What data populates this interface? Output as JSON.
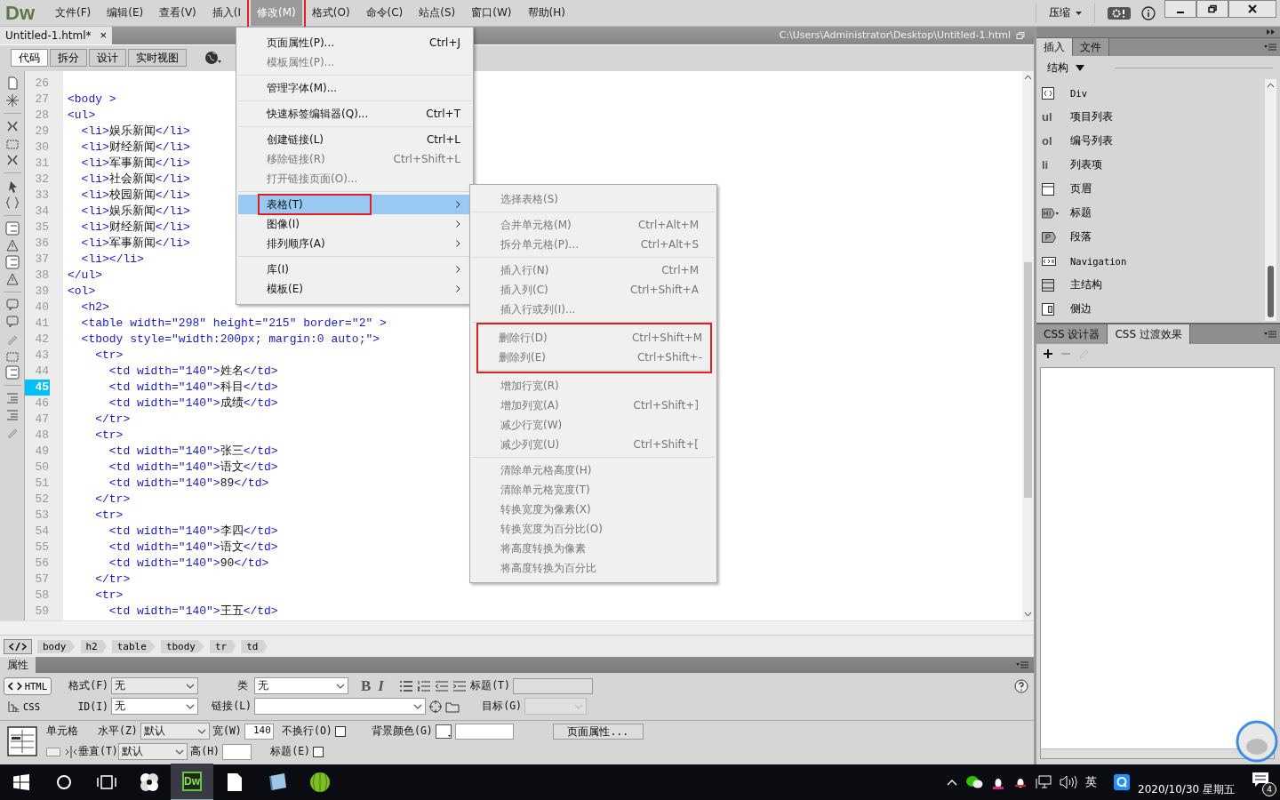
{
  "menubar": {
    "logo": "Dw",
    "items": [
      {
        "label": "文件(F)",
        "selected": false,
        "outlined": false
      },
      {
        "label": "编辑(E)",
        "selected": false,
        "outlined": false
      },
      {
        "label": "查看(V)",
        "selected": false,
        "outlined": false
      },
      {
        "label": "插入(I",
        "selected": false,
        "outlined": false
      },
      {
        "label": "修改(M)",
        "selected": true,
        "outlined": true
      },
      {
        "label": "格式(O)",
        "selected": false,
        "outlined": false
      },
      {
        "label": "命令(C)",
        "selected": false,
        "outlined": false
      },
      {
        "label": "站点(S)",
        "selected": false,
        "outlined": false
      },
      {
        "label": "窗口(W)",
        "selected": false,
        "outlined": false
      },
      {
        "label": "帮助(H)",
        "selected": false,
        "outlined": false
      }
    ],
    "workspace": "压缩"
  },
  "dropdown": {
    "sections": [
      {
        "items": [
          {
            "label": "页面属性(P)...",
            "shortcut": "Ctrl+J",
            "disabled": false,
            "selected": false,
            "submenu": false,
            "outlined": false
          },
          {
            "label": "模板属性(P)...",
            "disabled": true,
            "selected": false,
            "submenu": false,
            "outlined": false
          }
        ]
      },
      {
        "items": [
          {
            "label": "管理字体(M)...",
            "disabled": false,
            "selected": false,
            "submenu": false,
            "outlined": false
          }
        ]
      },
      {
        "items": [
          {
            "label": "快速标签编辑器(Q)...",
            "shortcut": "Ctrl+T",
            "disabled": false,
            "selected": false,
            "submenu": false,
            "outlined": false
          }
        ]
      },
      {
        "items": [
          {
            "label": "创建链接(L)",
            "shortcut": "Ctrl+L",
            "disabled": false,
            "selected": false,
            "submenu": false,
            "outlined": false
          },
          {
            "label": "移除链接(R)",
            "shortcut": "Ctrl+Shift+L",
            "disabled": true,
            "selected": false,
            "submenu": false,
            "outlined": false
          },
          {
            "label": "打开链接页面(O)...",
            "disabled": true,
            "selected": false,
            "submenu": false,
            "outlined": false
          }
        ]
      },
      {
        "items": [
          {
            "label": "表格(T)",
            "disabled": false,
            "selected": true,
            "submenu": true,
            "outlined": true
          },
          {
            "label": "图像(I)",
            "disabled": false,
            "selected": false,
            "submenu": true,
            "outlined": false
          },
          {
            "label": "排列顺序(A)",
            "disabled": false,
            "selected": false,
            "submenu": true,
            "outlined": false
          }
        ]
      },
      {
        "items": [
          {
            "label": "库(I)",
            "disabled": false,
            "selected": false,
            "submenu": true,
            "outlined": false
          },
          {
            "label": "模板(E)",
            "disabled": false,
            "selected": false,
            "submenu": true,
            "outlined": false
          }
        ]
      }
    ]
  },
  "submenu": {
    "sections": [
      {
        "outlined": false,
        "items": [
          {
            "label": "选择表格(S)",
            "disabled": true
          }
        ]
      },
      {
        "outlined": false,
        "items": [
          {
            "label": "合并单元格(M)",
            "shortcut": "Ctrl+Alt+M",
            "disabled": true
          },
          {
            "label": "拆分单元格(P)...",
            "shortcut": "Ctrl+Alt+S",
            "disabled": true
          }
        ]
      },
      {
        "outlined": false,
        "items": [
          {
            "label": "插入行(N)",
            "shortcut": "Ctrl+M",
            "disabled": true
          },
          {
            "label": "插入列(C)",
            "shortcut": "Ctrl+Shift+A",
            "disabled": true
          },
          {
            "label": "插入行或列(I)...",
            "disabled": true
          }
        ]
      },
      {
        "outlined": true,
        "items": [
          {
            "label": "删除行(D)",
            "shortcut": "Ctrl+Shift+M",
            "disabled": true
          },
          {
            "label": "删除列(E)",
            "shortcut": "Ctrl+Shift+-",
            "disabled": true
          }
        ]
      },
      {
        "outlined": false,
        "items": [
          {
            "label": "增加行宽(R)",
            "disabled": true
          },
          {
            "label": "增加列宽(A)",
            "shortcut": "Ctrl+Shift+]",
            "disabled": true
          },
          {
            "label": "减少行宽(W)",
            "disabled": true
          },
          {
            "label": "减少列宽(U)",
            "shortcut": "Ctrl+Shift+[",
            "disabled": true
          }
        ]
      },
      {
        "outlined": false,
        "items": [
          {
            "label": "清除单元格高度(H)",
            "disabled": true
          },
          {
            "label": "清除单元格宽度(T)",
            "disabled": true
          },
          {
            "label": "转换宽度为像素(X)",
            "disabled": true
          },
          {
            "label": "转换宽度为百分比(O)",
            "disabled": true
          },
          {
            "label": "将高度转换为像素",
            "disabled": true
          },
          {
            "label": "将高度转换为百分比",
            "disabled": true
          }
        ]
      }
    ]
  },
  "document": {
    "tab": {
      "label": "Untitled-1.html*",
      "close": "×"
    },
    "path": "C:\\Users\\Administrator\\Desktop\\Untitled-1.html",
    "views": [
      {
        "label": "代码",
        "selected": true
      },
      {
        "label": "拆分",
        "selected": false
      },
      {
        "label": "设计",
        "selected": false
      },
      {
        "label": "实时视图",
        "selected": false
      }
    ]
  },
  "code": {
    "lines": [
      {
        "number": "26",
        "current": false
      },
      {
        "number": "27",
        "text": "<body >",
        "current": false
      },
      {
        "number": "28",
        "text": "<ul>",
        "current": false
      },
      {
        "number": "29",
        "text": "  <li>娱乐新闻</li>",
        "current": false
      },
      {
        "number": "30",
        "text": "  <li>财经新闻</li>",
        "current": false
      },
      {
        "number": "31",
        "text": "  <li>军事新闻</li>",
        "current": false
      },
      {
        "number": "32",
        "text": "  <li>社会新闻</li>",
        "current": false
      },
      {
        "number": "33",
        "text": "  <li>校园新闻</li>",
        "current": false
      },
      {
        "number": "34",
        "text": "  <li>娱乐新闻</li>",
        "current": false
      },
      {
        "number": "35",
        "text": "  <li>财经新闻</li>",
        "current": false
      },
      {
        "number": "36",
        "text": "  <li>军事新闻</li>",
        "current": false
      },
      {
        "number": "37",
        "text": "  <li></li>",
        "current": false
      },
      {
        "number": "38",
        "text": "</ul>",
        "current": false
      },
      {
        "number": "39",
        "text": "<ol>",
        "current": false
      },
      {
        "number": "40",
        "text": "  <h2>",
        "current": false
      },
      {
        "number": "41",
        "text": "  <table width=\"298\" height=\"215\" border=\"2\" >",
        "current": false
      },
      {
        "number": "42",
        "text": "  <tbody style=\"width:200px; margin:0 auto;\">",
        "current": false
      },
      {
        "number": "43",
        "text": "    <tr>",
        "current": false
      },
      {
        "number": "44",
        "text": "      <td width=\"140\">姓名</td>",
        "current": false
      },
      {
        "number": "45",
        "text": "      <td width=\"140\">科目</td>",
        "current": true
      },
      {
        "number": "46",
        "text": "      <td width=\"140\">成绩</td>",
        "current": false
      },
      {
        "number": "47",
        "text": "    </tr>",
        "current": false
      },
      {
        "number": "48",
        "text": "    <tr>",
        "current": false
      },
      {
        "number": "49",
        "text": "      <td width=\"140\">张三</td>",
        "current": false
      },
      {
        "number": "50",
        "text": "      <td width=\"140\">语文</td>",
        "current": false
      },
      {
        "number": "51",
        "text": "      <td width=\"140\">89</td>",
        "current": false
      },
      {
        "number": "52",
        "text": "    </tr>",
        "current": false
      },
      {
        "number": "53",
        "text": "    <tr>",
        "current": false
      },
      {
        "number": "54",
        "text": "      <td width=\"140\">李四</td>",
        "current": false
      },
      {
        "number": "55",
        "text": "      <td width=\"140\">语文</td>",
        "current": false
      },
      {
        "number": "56",
        "text": "      <td width=\"140\">90</td>",
        "current": false
      },
      {
        "number": "57",
        "text": "    </tr>",
        "current": false
      },
      {
        "number": "58",
        "text": "    <tr>",
        "current": false
      },
      {
        "number": "59",
        "text": "      <td width=\"140\">王五</td>",
        "current": false
      }
    ]
  },
  "tag_selector": [
    "body",
    "h2",
    "table",
    "tbody",
    "tr",
    "td"
  ],
  "properties": {
    "title": "属性",
    "modes": [
      {
        "label": "HTML",
        "selected": true
      },
      {
        "label": "CSS",
        "selected": false
      }
    ],
    "format": {
      "label": "格式(F)",
      "value": "无"
    },
    "id": {
      "label": "ID(I)",
      "value": "无"
    },
    "class": {
      "label": "类",
      "value": "无"
    },
    "bold": "B",
    "italic": "I",
    "link": {
      "label": "链接(L)"
    },
    "title_field": {
      "label": "标题(T)"
    },
    "target": {
      "label": "目标(G)",
      "disabled": true
    },
    "cell": {
      "label": "单元格",
      "horizontal": {
        "label": "水平(Z)",
        "value": "默认"
      },
      "vertical": {
        "label": "垂直(T)",
        "value": "默认"
      },
      "width": {
        "label": "宽(W)",
        "value": "140"
      },
      "height": {
        "label": "高(H)"
      },
      "nowrap": {
        "label": "不换行(O)",
        "checked": false
      },
      "header": {
        "label": "标题(E)",
        "checked": false
      },
      "bg": {
        "label": "背景颜色(G)"
      },
      "page_props": "页面属性..."
    }
  },
  "insert_panel": {
    "tabs": [
      {
        "label": "插入",
        "selected": true
      },
      {
        "label": "文件",
        "selected": false
      }
    ],
    "category": "结构",
    "items": [
      {
        "kind": "div",
        "label": "Div"
      },
      {
        "kind": "text",
        "glyph": "ul",
        "label": "项目列表"
      },
      {
        "kind": "text",
        "glyph": "ol",
        "label": "编号列表"
      },
      {
        "kind": "text",
        "glyph": "li",
        "label": "列表项"
      },
      {
        "kind": "header",
        "label": "页眉"
      },
      {
        "kind": "heading",
        "label": "标题"
      },
      {
        "kind": "paragraph",
        "label": "段落"
      },
      {
        "kind": "nav",
        "label": "Navigation"
      },
      {
        "kind": "main",
        "label": "主结构"
      },
      {
        "kind": "aside",
        "label": "侧边"
      }
    ]
  },
  "css_panel": {
    "tabs": [
      {
        "label": "CSS 设计器",
        "selected": false
      },
      {
        "label": "CSS 过渡效果",
        "selected": true
      }
    ]
  },
  "taskbar": {
    "apps": [
      {
        "kind": "pinwheel",
        "selected": false
      },
      {
        "kind": "dw",
        "label": "Dw",
        "selected": true
      },
      {
        "kind": "file",
        "selected": false
      },
      {
        "kind": "tile",
        "selected": false
      },
      {
        "kind": "melon",
        "selected": false
      }
    ],
    "ime": "英",
    "date": "2020/10/30 星期五",
    "notifications": "4"
  }
}
